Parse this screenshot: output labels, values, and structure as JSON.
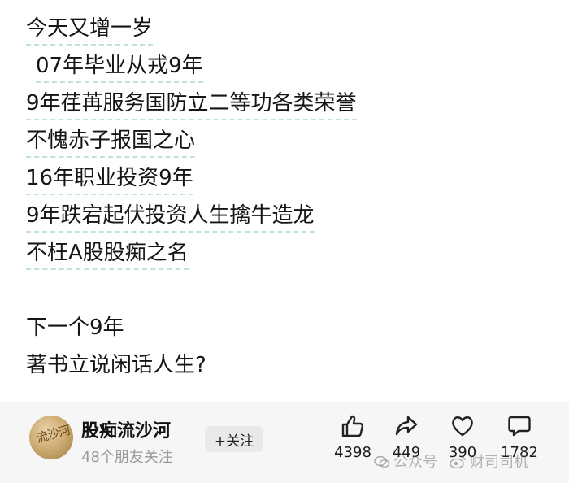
{
  "post": {
    "lines": [
      "今天又增一岁",
      "07年毕业从戎9年",
      "9年荏苒服务国防立二等功各类荣誉",
      "不愧赤子报国之心",
      "16年职业投资9年",
      "9年跌宕起伏投资人生擒牛造龙",
      "不枉A股股痴之名",
      "下一个9年",
      "著书立说闲话人生?"
    ]
  },
  "author": {
    "name": "股痴流沙河",
    "friends": "48个朋友关注",
    "avatar_text": "流沙河",
    "follow_label": "+关注"
  },
  "stats": {
    "likes": "4398",
    "shares": "449",
    "favorites": "390",
    "comments": "1782"
  },
  "watermark": {
    "left_text": "公众号",
    "right_text": "财司司机"
  }
}
